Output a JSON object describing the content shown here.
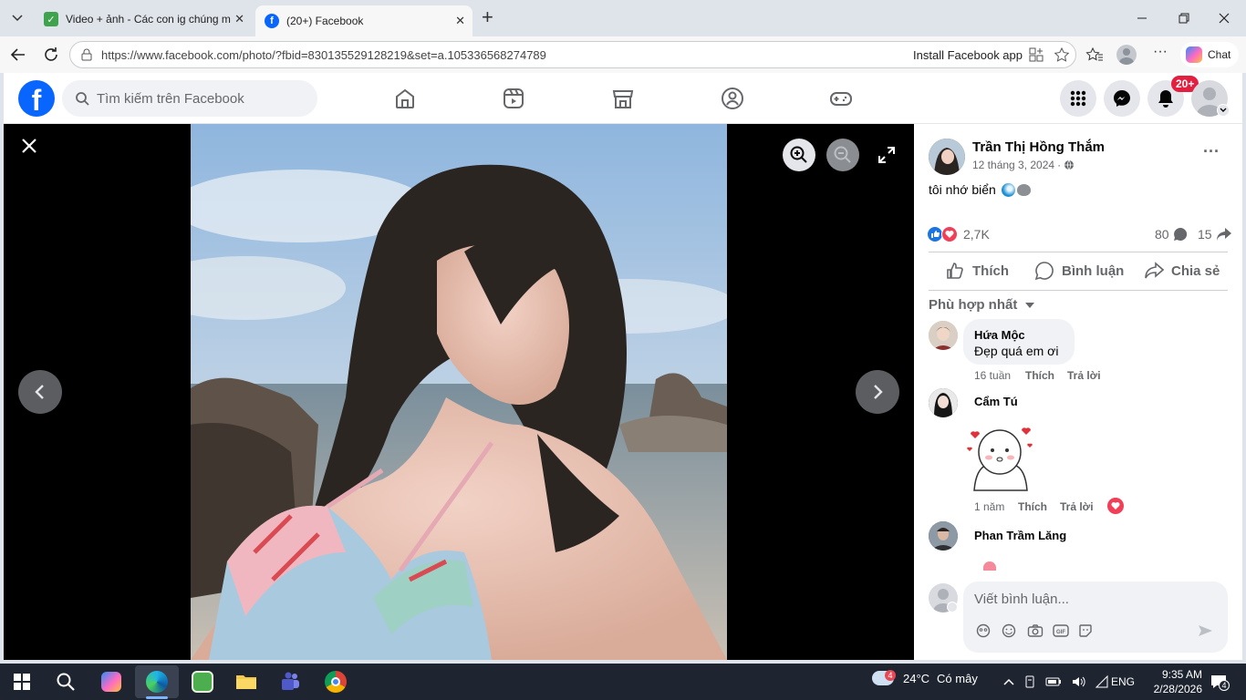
{
  "browser": {
    "tabs": [
      {
        "title": "Video + ảnh - Các con ig chúng m"
      },
      {
        "title": "(20+) Facebook"
      }
    ],
    "url": "https://www.facebook.com/photo/?fbid=830135529128219&set=a.105336568274789",
    "install_app": "Install Facebook app",
    "chat_label": "Chat"
  },
  "fb_header": {
    "search_placeholder": "Tìm kiếm trên Facebook",
    "notification_badge": "20+"
  },
  "post": {
    "author": "Trần Thị Hồng Thắm",
    "date": "12 tháng 3, 2024",
    "caption": "tôi nhớ biển",
    "reaction_count": "2,7K",
    "comment_count": "80",
    "share_count": "15",
    "actions": {
      "like": "Thích",
      "comment": "Bình luận",
      "share": "Chia sẻ"
    },
    "sort_label": "Phù hợp nhất"
  },
  "comments": [
    {
      "name": "Hứa Mộc",
      "text": "Đẹp quá em ơi",
      "time": "16 tuần",
      "like": "Thích",
      "reply": "Trả lời"
    },
    {
      "name": "Cẩm Tú",
      "time": "1 năm",
      "like": "Thích",
      "reply": "Trả lời"
    },
    {
      "name": "Phan Trầm Lăng"
    }
  ],
  "comment_box": {
    "placeholder": "Viết bình luận..."
  },
  "taskbar": {
    "weather_temp": "24°C",
    "weather_text": "Có mây",
    "weather_badge": "4",
    "language": "ENG",
    "time": "9:35 AM",
    "date": "2/28/2026",
    "notif_count": "4"
  },
  "colors": {
    "fb_blue": "#0866ff",
    "badge_red": "#e41e3f",
    "taskbar": "#1f2530"
  }
}
